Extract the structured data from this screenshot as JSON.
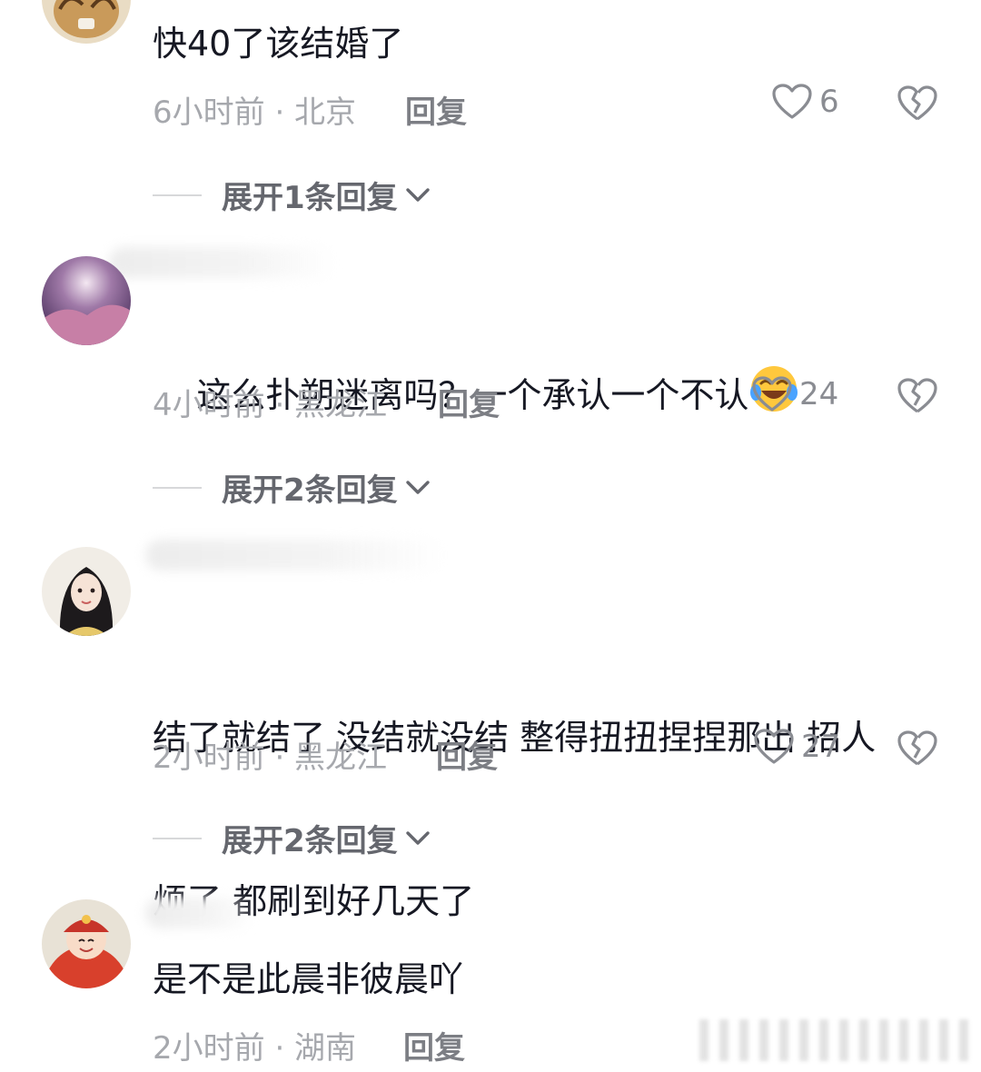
{
  "comments": [
    {
      "text": "快40了该结婚了",
      "meta": "6小时前 · 北京",
      "reply_label": "回复",
      "likes": "6",
      "expand_label": "展开1条回复",
      "avatar": "tiger-avatar"
    },
    {
      "text": "这么扑朔迷离吗？一个承认一个不认",
      "emoji": "laughing-crying-emoji",
      "meta": "4小时前 · 黑龙江",
      "reply_label": "回复",
      "likes": "24",
      "expand_label": "展开2条回复",
      "avatar": "purple-landscape-avatar"
    },
    {
      "text_line1": "结了就结了 没结就没结 整得扭扭捏捏那出 招人",
      "text_line2": "烦了 都刷到好几天了",
      "meta": "2小时前 · 黑龙江",
      "reply_label": "回复",
      "likes": "27",
      "expand_label": "展开2条回复",
      "avatar": "girl-portrait-avatar"
    },
    {
      "text": "是不是此晨非彼晨吖",
      "meta": "2小时前 · 湖南",
      "reply_label": "回复",
      "avatar": "red-costume-child-avatar"
    }
  ],
  "colors": {
    "text": "#161823",
    "meta": "#a6a8ad",
    "icon": "#8a8c92"
  }
}
